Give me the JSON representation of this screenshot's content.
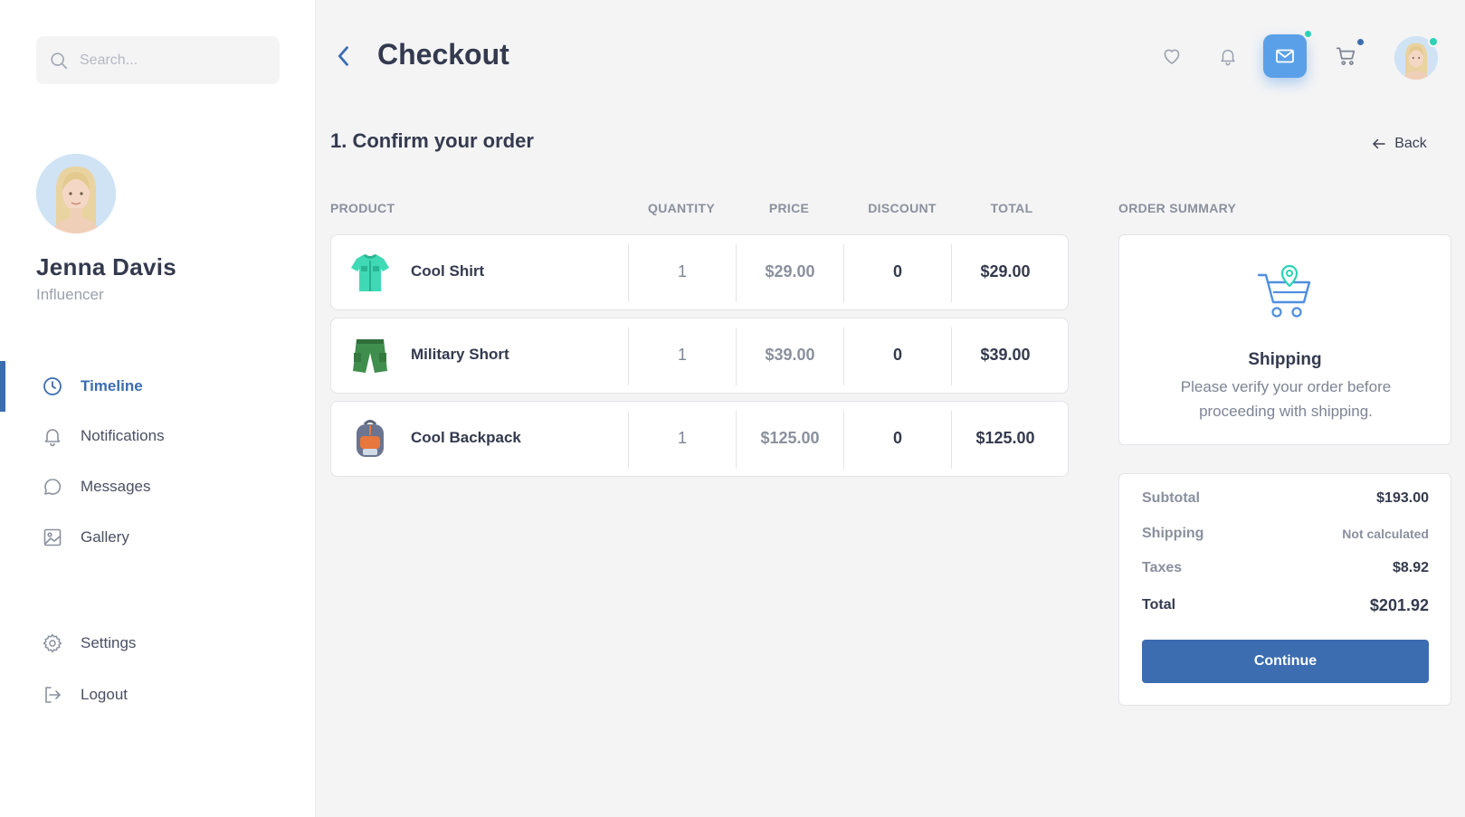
{
  "sidebar": {
    "search_placeholder": "Search...",
    "user": {
      "name": "Jenna Davis",
      "role": "Influencer"
    },
    "items": [
      {
        "label": "Timeline",
        "icon": "clock-icon",
        "active": true
      },
      {
        "label": "Notifications",
        "icon": "bell-icon"
      },
      {
        "label": "Messages",
        "icon": "chat-bubble-icon"
      },
      {
        "label": "Gallery",
        "icon": "image-icon"
      },
      {
        "label": "Settings",
        "icon": "gear-icon"
      },
      {
        "label": "Logout",
        "icon": "logout-icon"
      }
    ]
  },
  "header": {
    "title": "Checkout",
    "icons": [
      "heart-icon",
      "bell-icon",
      "mail-icon",
      "cart-icon",
      "avatar"
    ]
  },
  "section": {
    "title": "1. Confirm your order",
    "back_label": "Back"
  },
  "table": {
    "headers": {
      "product": "PRODUCT",
      "quantity": "QUANTITY",
      "price": "PRICE",
      "discount": "DISCOUNT",
      "total": "TOTAL"
    },
    "rows": [
      {
        "name": "Cool Shirt",
        "qty": "1",
        "price": "$29.00",
        "discount": "0",
        "total": "$29.00",
        "icon": "shirt-icon"
      },
      {
        "name": "Military Short",
        "qty": "1",
        "price": "$39.00",
        "discount": "0",
        "total": "$39.00",
        "icon": "shorts-icon"
      },
      {
        "name": "Cool Backpack",
        "qty": "1",
        "price": "$125.00",
        "discount": "0",
        "total": "$125.00",
        "icon": "backpack-icon"
      }
    ]
  },
  "summary": {
    "heading": "ORDER SUMMARY",
    "shipping_title": "Shipping",
    "shipping_text": "Please verify your order before proceeding with shipping.",
    "lines": [
      {
        "label": "Subtotal",
        "value": "$193.00"
      },
      {
        "label": "Shipping",
        "value": "Not calculated"
      },
      {
        "label": "Taxes",
        "value": "$8.92"
      },
      {
        "label": "Total",
        "value": "$201.92"
      }
    ],
    "continue_label": "Continue"
  },
  "colors": {
    "accent": "#3b6db0",
    "mail": "#5aa0e8",
    "teal_dot": "#2ad3b5",
    "blue_dot": "#3b6db0"
  }
}
